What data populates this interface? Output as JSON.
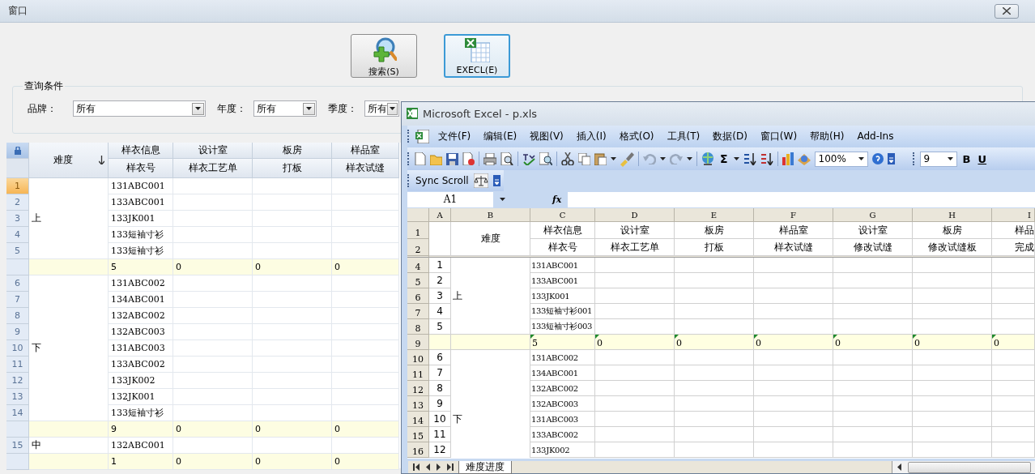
{
  "window": {
    "title": "窗口"
  },
  "buttons": [
    {
      "kind": "search",
      "label": "搜索(S)",
      "focused": false
    },
    {
      "kind": "excel",
      "label": "EXECL(E)",
      "focused": true
    }
  ],
  "query": {
    "title": "查询条件",
    "fields": [
      {
        "label": "品牌：",
        "value": "所有"
      },
      {
        "label": "年度：",
        "value": "所有"
      },
      {
        "label": "季度：",
        "value": "所有"
      }
    ]
  },
  "grid": {
    "difficulty_header": "难度",
    "columns": [
      {
        "group": "样衣信息",
        "name": "样衣号"
      },
      {
        "group": "设计室",
        "name": "样衣工艺单"
      },
      {
        "group": "板房",
        "name": "打板"
      },
      {
        "group": "样品室",
        "name": "样衣试缝"
      }
    ],
    "sections": [
      {
        "difficulty": "上",
        "rows": [
          {
            "number": "1",
            "code": "131ABC001",
            "selected": true
          },
          {
            "number": "2",
            "code": "133ABC001",
            "selected": false
          },
          {
            "number": "3",
            "code": "133JK001",
            "selected": false
          },
          {
            "number": "4",
            "code": "133短袖寸衫",
            "selected": false
          },
          {
            "number": "5",
            "code": "133短袖寸衫",
            "selected": false
          }
        ],
        "totals": [
          "5",
          "0",
          "0",
          "0"
        ]
      },
      {
        "difficulty": "下",
        "rows": [
          {
            "number": "6",
            "code": "131ABC002",
            "selected": false
          },
          {
            "number": "7",
            "code": "134ABC001",
            "selected": false
          },
          {
            "number": "8",
            "code": "132ABC002",
            "selected": false
          },
          {
            "number": "9",
            "code": "132ABC003",
            "selected": false
          },
          {
            "number": "10",
            "code": "131ABC003",
            "selected": false
          },
          {
            "number": "11",
            "code": "133ABC002",
            "selected": false
          },
          {
            "number": "12",
            "code": "133JK002",
            "selected": false
          },
          {
            "number": "13",
            "code": "132JK001",
            "selected": false
          },
          {
            "number": "14",
            "code": "133短袖寸衫",
            "selected": false
          }
        ],
        "totals": [
          "9",
          "0",
          "0",
          "0"
        ]
      },
      {
        "difficulty": "中",
        "rows": [
          {
            "number": "15",
            "code": "132ABC001",
            "selected": false
          }
        ],
        "totals": [
          "1",
          "0",
          "0",
          "0"
        ]
      }
    ]
  },
  "excel": {
    "title": "Microsoft Excel - p.xls",
    "menu": [
      "文件(F)",
      "编辑(E)",
      "视图(V)",
      "插入(I)",
      "格式(O)",
      "工具(T)",
      "数据(D)",
      "窗口(W)",
      "帮助(H)",
      "Add-Ins"
    ],
    "toolbar": {
      "autosum": "Σ",
      "zoom": "100%",
      "font_size": "9",
      "bold": "B",
      "underline": "U"
    },
    "sync_scroll": "Sync Scroll",
    "name_box": "A1",
    "fx": "fx",
    "column_letters": [
      "A",
      "B",
      "C",
      "D",
      "E",
      "F",
      "G",
      "H",
      "I"
    ],
    "header": {
      "row_numbers": [
        "1",
        "2"
      ],
      "difficulty": "难度",
      "groups": [
        "样衣信息",
        "设计室",
        "板房",
        "样品室",
        "设计室",
        "板房",
        "样品"
      ],
      "names": [
        "样衣号",
        "样衣工艺单",
        "打板",
        "样衣试缝",
        "修改试缝",
        "修改试缝板",
        "完成"
      ]
    },
    "sections": [
      {
        "rows": [
          {
            "row": "4",
            "index": "1",
            "code": "131ABC001"
          },
          {
            "row": "5",
            "index": "2",
            "code": "133ABC001"
          },
          {
            "row": "6",
            "index": "3",
            "difficulty": "上",
            "code": "133JK001"
          },
          {
            "row": "7",
            "index": "4",
            "code": "133短袖寸衫001"
          },
          {
            "row": "8",
            "index": "5",
            "code": "133短袖寸衫003"
          }
        ],
        "total_row": "9",
        "totals": [
          "5",
          "0",
          "0",
          "0",
          "0",
          "0",
          "0"
        ]
      },
      {
        "rows": [
          {
            "row": "10",
            "index": "6",
            "code": "131ABC002"
          },
          {
            "row": "11",
            "index": "7",
            "code": "134ABC001"
          },
          {
            "row": "12",
            "index": "8",
            "code": "132ABC002"
          },
          {
            "row": "13",
            "index": "9",
            "code": "132ABC003"
          },
          {
            "row": "14",
            "index": "10",
            "difficulty": "下",
            "code": "131ABC003"
          },
          {
            "row": "15",
            "index": "11",
            "code": "133ABC002"
          },
          {
            "row": "16",
            "index": "12",
            "code": "133JK002"
          }
        ]
      }
    ],
    "sheet_tab": "难度进度"
  }
}
